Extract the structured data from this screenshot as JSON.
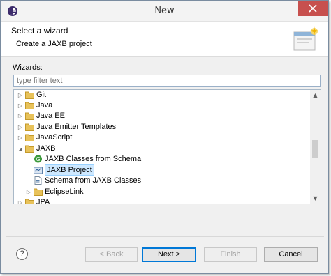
{
  "window": {
    "title": "New"
  },
  "header": {
    "title": "Select a wizard",
    "description": "Create a JAXB project"
  },
  "wizards": {
    "label": "Wizards:",
    "filter_placeholder": "type filter text"
  },
  "tree": {
    "items": [
      {
        "label": "Git",
        "expanded": false,
        "icon": "folder-icon",
        "selected": false
      },
      {
        "label": "Java",
        "expanded": false,
        "icon": "folder-icon",
        "selected": false
      },
      {
        "label": "Java EE",
        "expanded": false,
        "icon": "folder-icon",
        "selected": false
      },
      {
        "label": "Java Emitter Templates",
        "expanded": false,
        "icon": "folder-icon",
        "selected": false
      },
      {
        "label": "JavaScript",
        "expanded": false,
        "icon": "folder-icon",
        "selected": false
      },
      {
        "label": "JAXB",
        "expanded": true,
        "icon": "folder-icon",
        "selected": false
      },
      {
        "label": "JAXB Classes from Schema",
        "icon": "classes-icon",
        "selected": false
      },
      {
        "label": "JAXB Project",
        "icon": "project-icon",
        "selected": true
      },
      {
        "label": "Schema from JAXB Classes",
        "icon": "schema-icon",
        "selected": false
      },
      {
        "label": "EclipseLink",
        "expanded": false,
        "icon": "folder-icon",
        "selected": false
      },
      {
        "label": "JPA",
        "expanded": false,
        "icon": "folder-icon",
        "selected": false
      }
    ]
  },
  "buttons": {
    "help": "?",
    "back": "< Back",
    "next": "Next >",
    "finish": "Finish",
    "cancel": "Cancel"
  },
  "colors": {
    "close_button": "#c7504e",
    "selection_bg": "#cde8ff",
    "folder": "#e8c25a",
    "default_button_border": "#0078d7"
  }
}
